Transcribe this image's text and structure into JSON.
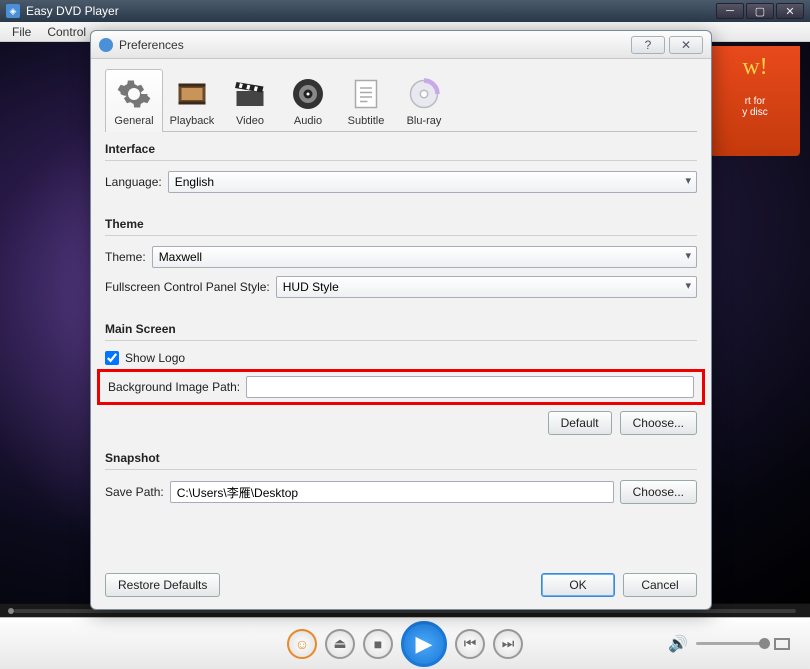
{
  "main": {
    "title": "Easy DVD Player",
    "menu": {
      "file": "File",
      "control": "Control"
    },
    "promo": {
      "big": "w!",
      "line1": "rt for",
      "line2": "y disc"
    }
  },
  "dialog": {
    "title": "Preferences",
    "tabs": {
      "general": "General",
      "playback": "Playback",
      "video": "Video",
      "audio": "Audio",
      "subtitle": "Subtitle",
      "bluray": "Blu-ray"
    },
    "interface": {
      "heading": "Interface",
      "language_label": "Language:",
      "language_value": "English"
    },
    "theme": {
      "heading": "Theme",
      "theme_label": "Theme:",
      "theme_value": "Maxwell",
      "fcps_label": "Fullscreen Control Panel Style:",
      "fcps_value": "HUD Style"
    },
    "main_screen": {
      "heading": "Main Screen",
      "show_logo": "Show Logo",
      "show_logo_checked": true,
      "bg_path_label": "Background Image Path:",
      "bg_path_value": "",
      "default_btn": "Default",
      "choose_btn": "Choose..."
    },
    "snapshot": {
      "heading": "Snapshot",
      "save_path_label": "Save Path:",
      "save_path_value": "C:\\Users\\李雁\\Desktop",
      "choose_btn": "Choose..."
    },
    "footer": {
      "restore": "Restore Defaults",
      "ok": "OK",
      "cancel": "Cancel"
    }
  }
}
